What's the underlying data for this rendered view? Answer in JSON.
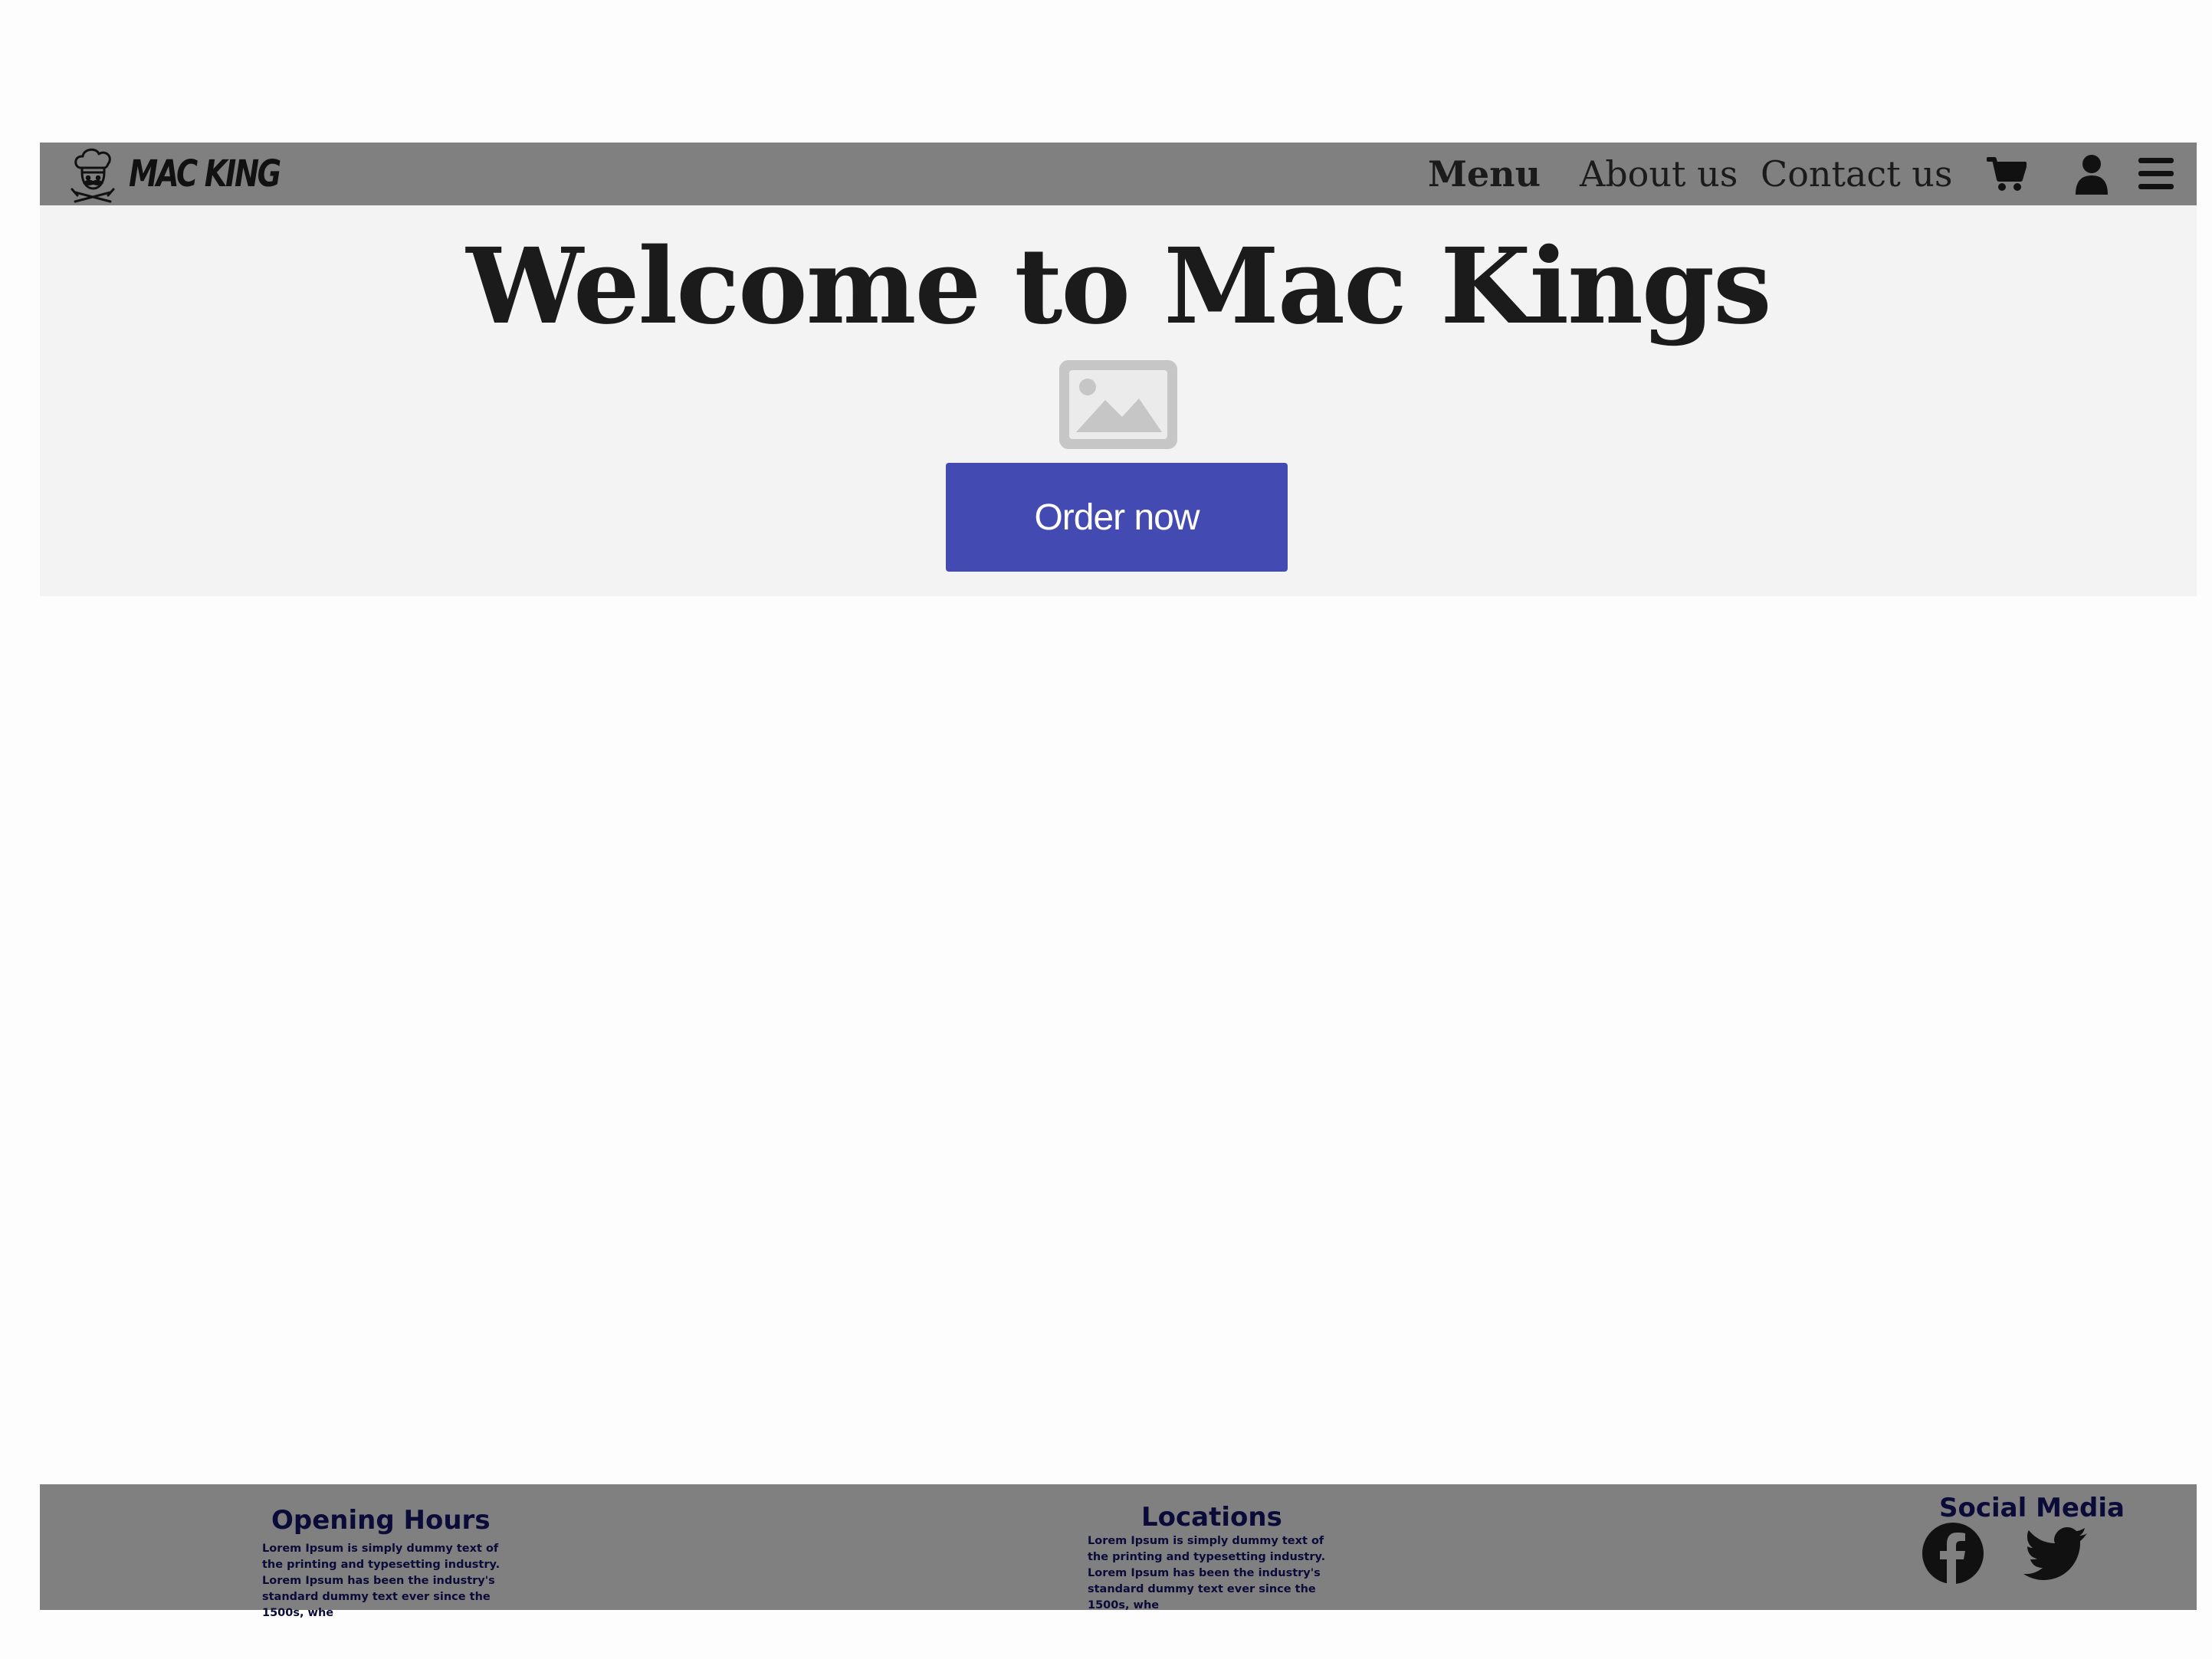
{
  "navbar": {
    "logo_icon": "chef-logo-icon",
    "brand_name": "MAC KING",
    "links": [
      {
        "label": "Menu",
        "active": true
      },
      {
        "label": "About us",
        "active": false
      },
      {
        "label": "Contact us",
        "active": false
      }
    ],
    "icons": [
      "cart-icon",
      "user-icon",
      "hamburger-menu-icon"
    ]
  },
  "hero": {
    "title": "Welcome to Mac Kings",
    "image_icon": "image-placeholder-icon",
    "cta_label": "Order now"
  },
  "footer": {
    "opening_hours": {
      "title": "Opening Hours",
      "text": "Lorem Ipsum is simply dummy text of the printing and typesetting industry. Lorem Ipsum has been the industry's standard dummy text ever since the 1500s, whe"
    },
    "locations": {
      "title": "Locations",
      "text": "Lorem Ipsum is simply dummy text of the printing and typesetting industry. Lorem Ipsum has been the industry's standard dummy text ever since the 1500s, whe"
    },
    "social_media": {
      "title": "Social Media",
      "icons": [
        "facebook-icon",
        "twitter-icon"
      ]
    }
  },
  "colors": {
    "navbar_bg": "#808080",
    "hero_bg": "#f3f3f3",
    "cta_bg": "#434ab1",
    "cta_text": "#ffffff",
    "footer_bg": "#808080",
    "footer_text": "#0b0b3a",
    "text_dark": "#1b1b1b"
  }
}
